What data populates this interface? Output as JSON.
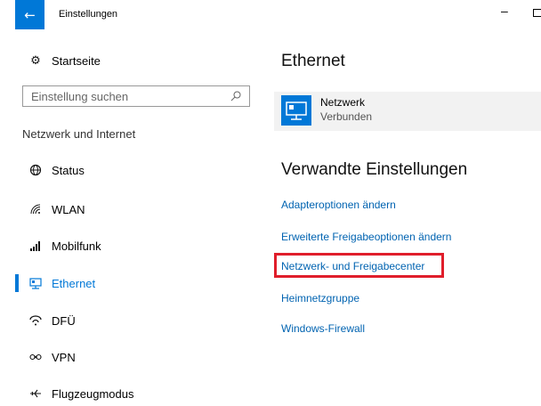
{
  "titlebar": {
    "title": "Einstellungen",
    "minimize": "–"
  },
  "sidebar": {
    "home_label": "Startseite",
    "search_placeholder": "Einstellung suchen",
    "section_label": "Netzwerk und Internet",
    "items": [
      {
        "label": "Status",
        "icon": "globe-icon"
      },
      {
        "label": "WLAN",
        "icon": "wifi-icon"
      },
      {
        "label": "Mobilfunk",
        "icon": "cellular-icon"
      },
      {
        "label": "Ethernet",
        "icon": "ethernet-icon",
        "selected": true
      },
      {
        "label": "DFÜ",
        "icon": "dialup-icon"
      },
      {
        "label": "VPN",
        "icon": "vpn-icon"
      },
      {
        "label": "Flugzeugmodus",
        "icon": "airplane-icon"
      }
    ]
  },
  "main": {
    "heading": "Ethernet",
    "network": {
      "name": "Netzwerk",
      "status": "Verbunden"
    },
    "related_heading": "Verwandte Einstellungen",
    "links": [
      "Adapteroptionen ändern",
      "Erweiterte Freigabeoptionen ändern",
      "Netzwerk- und Freigabecenter",
      "Heimnetzgruppe",
      "Windows-Firewall"
    ]
  },
  "colors": {
    "accent": "#0078d7",
    "link": "#0063b1",
    "highlight": "#e01e2b"
  }
}
